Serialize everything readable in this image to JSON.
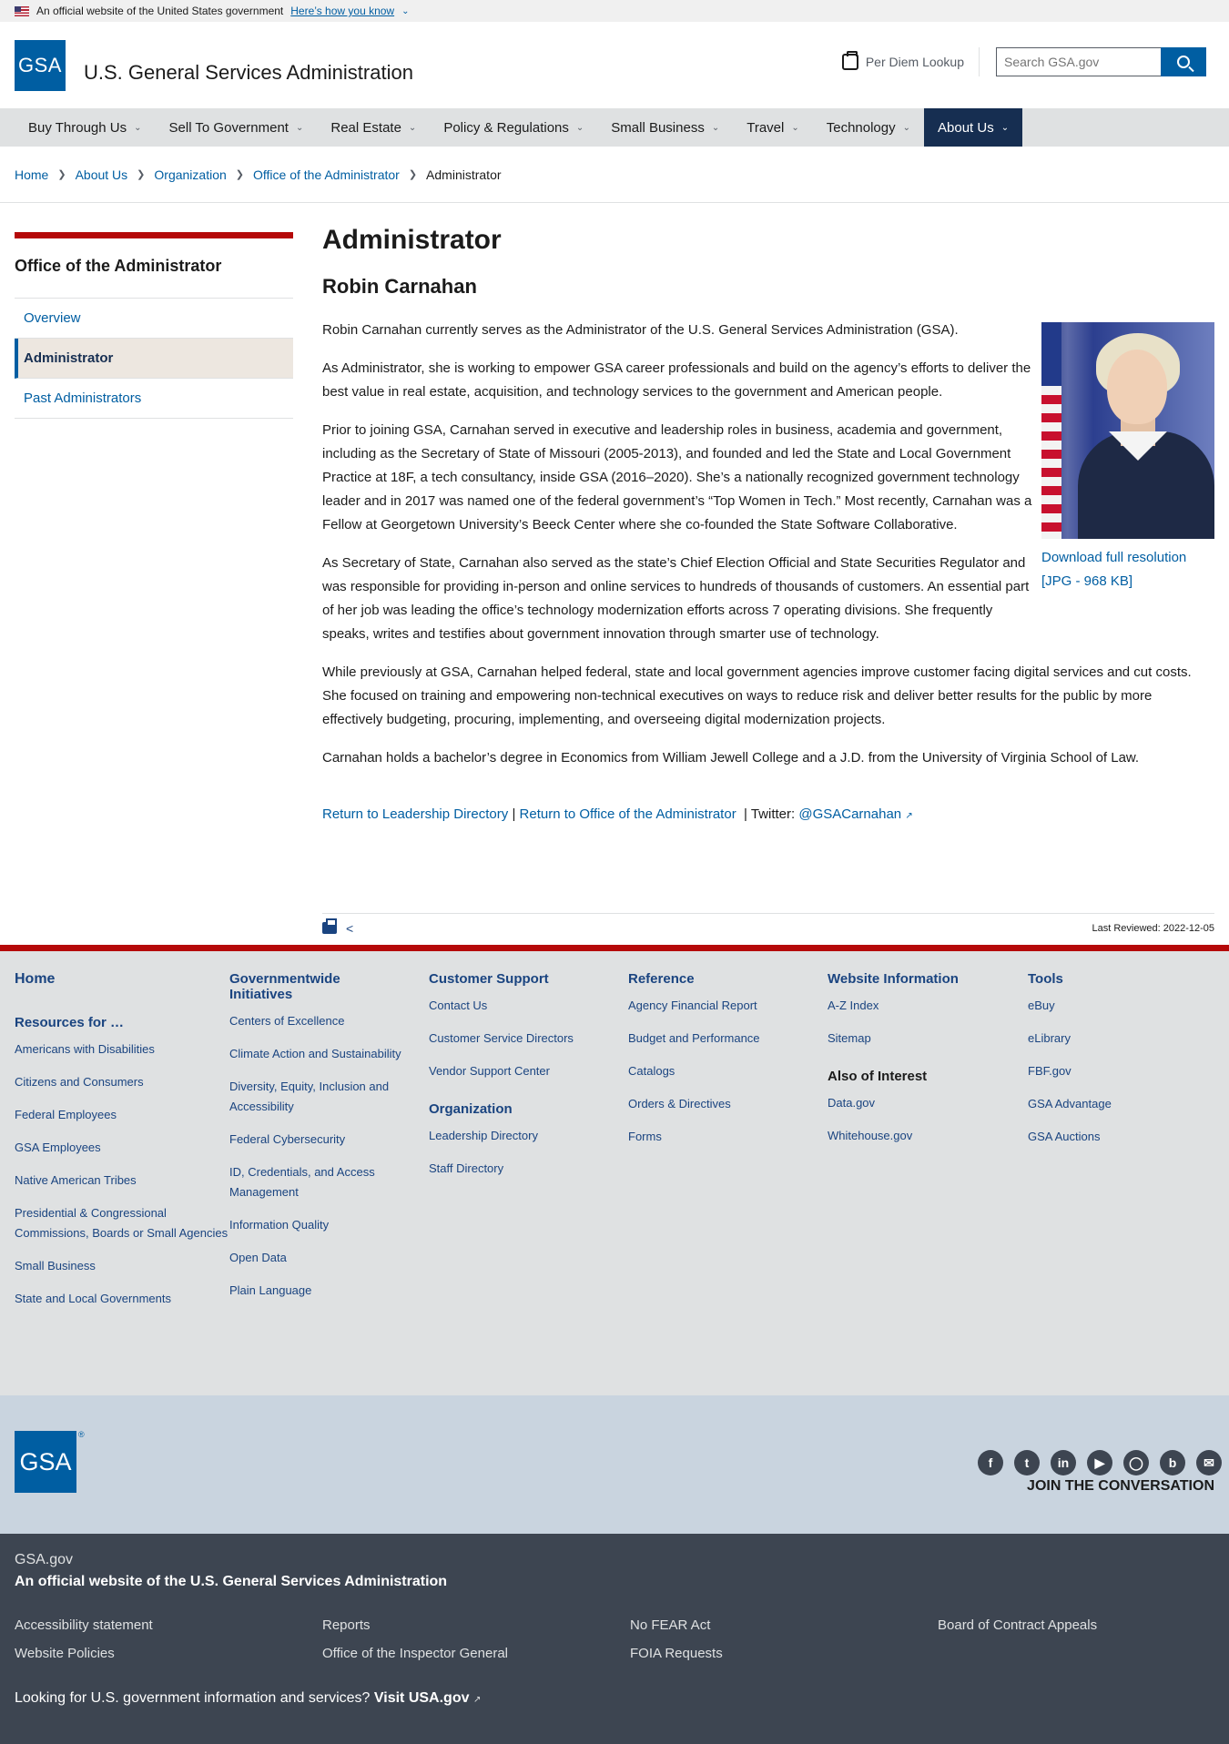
{
  "banner": {
    "text": "An official website of the United States government",
    "link": "Here’s how you know"
  },
  "header": {
    "logo": "GSA",
    "title": "U.S. General Services Administration",
    "perdiem": "Per Diem Lookup",
    "search_placeholder": "Search GSA.gov"
  },
  "nav": [
    "Buy Through Us",
    "Sell To Government",
    "Real Estate",
    "Policy & Regulations",
    "Small Business",
    "Travel",
    "Technology",
    "About Us"
  ],
  "breadcrumb": [
    "Home",
    "About Us",
    "Organization",
    "Office of the Administrator",
    "Administrator"
  ],
  "sidenav": {
    "title": "Office of the Administrator",
    "items": [
      "Overview",
      "Administrator",
      "Past Administrators"
    ]
  },
  "main": {
    "heading": "Administrator",
    "name": "Robin Carnahan",
    "paragraphs": [
      "Robin Carnahan currently serves as the Administrator of the U.S. General Services Administration (GSA).",
      "As Administrator, she is working to empower GSA career professionals and build on the agency’s efforts to deliver the best value in real estate, acquisition, and technology services to the government and American people.",
      "Prior to joining GSA, Carnahan served in executive and leadership roles in business, academia and government, including as the Secretary of State of Missouri (2005-2013), and founded and led the State and Local Government Practice at 18F, a tech consultancy, inside GSA (2016–2020). She’s a nationally recognized government technology leader and in 2017 was named one of the federal government’s “Top Women in Tech.” Most recently, Carnahan was a Fellow at Georgetown University’s Beeck Center where she co-founded the State Software Collaborative.",
      "As Secretary of State, Carnahan also served as the state’s Chief Election Official and State Securities Regulator and was responsible for providing in-person and online services to hundreds of thousands of customers. An essential part of her job was leading the office’s technology modernization efforts across 7 operating divisions. She frequently speaks, writes and testifies about government innovation through smarter use of technology.",
      "While previously at GSA, Carnahan helped federal, state and local government agencies improve customer facing digital services and cut costs. She focused on training and empowering non-technical executives on ways to reduce risk and deliver better results for the public by more effectively budgeting, procuring, implementing, and overseeing digital modernization projects.",
      "Carnahan holds a bachelor’s degree in Economics from William Jewell College and a J.D. from the University of Virginia School of Law."
    ],
    "download_line1": "Download full resolution",
    "download_line2": "[JPG - 968 KB]",
    "return_leadership": "Return to Leadership Directory",
    "return_office": "Return to Office of the Administrator",
    "twitter_label": "| Twitter:",
    "twitter_handle": "@GSACarnahan",
    "last_reviewed": "Last Reviewed: 2022-12-05"
  },
  "footer": {
    "col1": {
      "home": "Home",
      "resources": "Resources for …",
      "links": [
        "Americans with Disabilities",
        "Citizens and Consumers",
        "Federal Employees",
        "GSA Employees",
        "Native American Tribes",
        "Presidential & Congressional Commissions, Boards or Small Agencies",
        "Small Business",
        "State and Local Governments"
      ]
    },
    "col2": {
      "head": "Governmentwide Initiatives",
      "links": [
        "Centers of Excellence",
        "Climate Action and Sustainability",
        "Diversity, Equity, Inclusion and Accessibility",
        "Federal Cybersecurity",
        "ID, Credentials, and Access Management",
        "Information Quality",
        "Open Data",
        "Plain Language"
      ]
    },
    "col3": {
      "head": "Customer Support",
      "links": [
        "Contact Us",
        "Customer Service Directors",
        "Vendor Support Center"
      ],
      "head2": "Organization",
      "links2": [
        "Leadership Directory",
        "Staff Directory"
      ]
    },
    "col4": {
      "head": "Reference",
      "links": [
        "Agency Financial Report",
        "Budget and Performance",
        "Catalogs",
        "Orders & Directives",
        "Forms"
      ]
    },
    "col5": {
      "head": "Website Information",
      "links": [
        "A-Z Index",
        "Sitemap"
      ],
      "head2": "Also of Interest",
      "links2": [
        "Data.gov",
        "Whitehouse.gov"
      ]
    },
    "col6": {
      "head": "Tools",
      "links": [
        "eBuy",
        "eLibrary",
        "FBF.gov",
        "GSA Advantage",
        "GSA Auctions"
      ]
    },
    "logo": "GSA",
    "join": "JOIN THE CONVERSATION",
    "site": "GSA.gov",
    "official": "An official website of the U.S. General Services Administration",
    "bottom_links": [
      "Accessibility statement",
      "Reports",
      "No FEAR Act",
      "Board of Contract Appeals",
      "Website Policies",
      "Office of the Inspector General",
      "FOIA Requests"
    ],
    "usa_text": "Looking for U.S. government information and services?",
    "usa_link": "Visit USA.gov"
  }
}
